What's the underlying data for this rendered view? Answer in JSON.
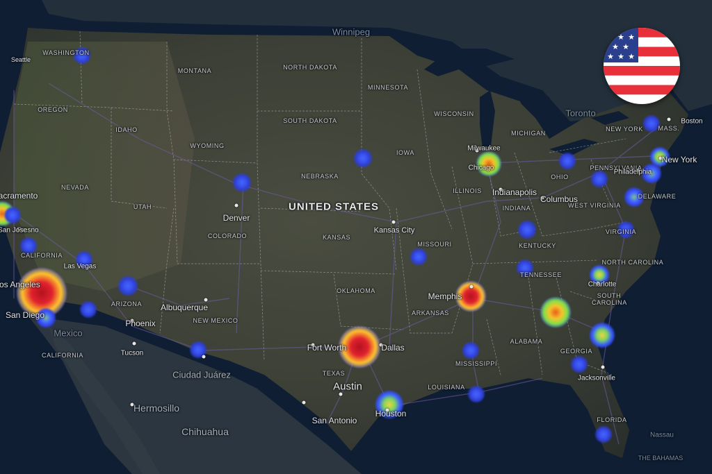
{
  "country_label": "UNITED STATES",
  "flag": {
    "name": "us-flag-icon",
    "red": "#e8303a",
    "white": "#ffffff",
    "blue": "#2b3f8f"
  },
  "faint_labels": [
    {
      "name": "winnipeg",
      "text": "Winnipeg"
    },
    {
      "name": "toronto",
      "text": "Toronto"
    },
    {
      "name": "mexico",
      "text": "Mexico"
    },
    {
      "name": "nassau",
      "text": "Nassau"
    },
    {
      "name": "the-bahamas",
      "text": "THE BAHAMAS"
    }
  ],
  "state_labels": [
    {
      "name": "washington",
      "text": "WASHINGTON"
    },
    {
      "name": "montana",
      "text": "MONTANA"
    },
    {
      "name": "north-dakota",
      "text": "NORTH DAKOTA"
    },
    {
      "name": "minnesota",
      "text": "MINNESOTA"
    },
    {
      "name": "oregon",
      "text": "OREGON"
    },
    {
      "name": "idaho",
      "text": "IDAHO"
    },
    {
      "name": "south-dakota",
      "text": "SOUTH DAKOTA"
    },
    {
      "name": "wisconsin",
      "text": "WISCONSIN"
    },
    {
      "name": "michigan",
      "text": "MICHIGAN"
    },
    {
      "name": "wyoming",
      "text": "WYOMING"
    },
    {
      "name": "iowa",
      "text": "IOWA"
    },
    {
      "name": "nebraska",
      "text": "NEBRASKA"
    },
    {
      "name": "nevada",
      "text": "NEVADA"
    },
    {
      "name": "utah",
      "text": "UTAH"
    },
    {
      "name": "illinois",
      "text": "ILLINOIS"
    },
    {
      "name": "indiana",
      "text": "INDIANA"
    },
    {
      "name": "ohio",
      "text": "OHIO"
    },
    {
      "name": "pennsylvania",
      "text": "PENNSYLVANIA"
    },
    {
      "name": "new-york",
      "text": "NEW YORK"
    },
    {
      "name": "mass",
      "text": "MASS."
    },
    {
      "name": "colorado",
      "text": "COLORADO"
    },
    {
      "name": "kansas",
      "text": "KANSAS"
    },
    {
      "name": "missouri",
      "text": "MISSOURI"
    },
    {
      "name": "kentucky",
      "text": "KENTUCKY"
    },
    {
      "name": "west-virginia",
      "text": "WEST VIRGINIA"
    },
    {
      "name": "virginia",
      "text": "VIRGINIA"
    },
    {
      "name": "delaware",
      "text": "DELAWARE"
    },
    {
      "name": "california",
      "text": "CALIFORNIA"
    },
    {
      "name": "arizona",
      "text": "ARIZONA"
    },
    {
      "name": "new-mexico",
      "text": "NEW MEXICO"
    },
    {
      "name": "oklahoma",
      "text": "OKLAHOMA"
    },
    {
      "name": "arkansas",
      "text": "ARKANSAS"
    },
    {
      "name": "tennessee",
      "text": "TENNESSEE"
    },
    {
      "name": "north-carolina",
      "text": "NORTH CAROLINA"
    },
    {
      "name": "south-carolina",
      "text": "SOUTH CAROLINA"
    },
    {
      "name": "texas",
      "text": "TEXAS"
    },
    {
      "name": "mississippi",
      "text": "MISSISSIPPI"
    },
    {
      "name": "alabama",
      "text": "ALABAMA"
    },
    {
      "name": "georgia",
      "text": "GEORGIA"
    },
    {
      "name": "louisiana",
      "text": "LOUISIANA"
    },
    {
      "name": "florida",
      "text": "FLORIDA"
    },
    {
      "name": "baja-california",
      "text": "CALIFORNIA"
    }
  ],
  "city_labels": [
    {
      "name": "seattle",
      "text": "Seattle"
    },
    {
      "name": "sacramento",
      "text": "Sacramento"
    },
    {
      "name": "fresno",
      "text": "Fresno"
    },
    {
      "name": "san-jose",
      "text": "San Jose"
    },
    {
      "name": "los-angeles",
      "text": "Los Angeles"
    },
    {
      "name": "las-vegas",
      "text": "Las Vegas"
    },
    {
      "name": "san-diego",
      "text": "San Diego"
    },
    {
      "name": "phoenix",
      "text": "Phoenix"
    },
    {
      "name": "tucson",
      "text": "Tucson"
    },
    {
      "name": "albuquerque",
      "text": "Albuquerque"
    },
    {
      "name": "denver",
      "text": "Denver"
    },
    {
      "name": "kansas-city",
      "text": "Kansas City"
    },
    {
      "name": "milwaukee",
      "text": "Milwaukee"
    },
    {
      "name": "chicago",
      "text": "Chicago"
    },
    {
      "name": "indianapolis",
      "text": "Indianapolis"
    },
    {
      "name": "columbus",
      "text": "Columbus"
    },
    {
      "name": "philadelphia",
      "text": "Philadelphia"
    },
    {
      "name": "new-york-city",
      "text": "New York"
    },
    {
      "name": "boston",
      "text": "Boston"
    },
    {
      "name": "memphis",
      "text": "Memphis"
    },
    {
      "name": "charlotte",
      "text": "Charlotte"
    },
    {
      "name": "fort-worth",
      "text": "Fort Worth"
    },
    {
      "name": "dallas",
      "text": "Dallas"
    },
    {
      "name": "austin",
      "text": "Austin"
    },
    {
      "name": "houston",
      "text": "Houston"
    },
    {
      "name": "san-antonio",
      "text": "San Antonio"
    },
    {
      "name": "jacksonville",
      "text": "Jacksonville"
    },
    {
      "name": "ciudad-juarez",
      "text": "Ciudad Juárez"
    },
    {
      "name": "hermosillo",
      "text": "Hermosillo"
    },
    {
      "name": "chihuahua",
      "text": "Chihuahua"
    }
  ],
  "hotspots": [
    {
      "name": "los-angeles",
      "intensity": 1.0
    },
    {
      "name": "fort-worth-dallas",
      "intensity": 0.95
    },
    {
      "name": "memphis",
      "intensity": 0.9
    },
    {
      "name": "san-jose",
      "intensity": 0.75
    },
    {
      "name": "atlanta",
      "intensity": 0.6
    },
    {
      "name": "chicago",
      "intensity": 0.55
    },
    {
      "name": "houston",
      "intensity": 0.45
    },
    {
      "name": "savannah",
      "intensity": 0.4
    },
    {
      "name": "charlotte",
      "intensity": 0.3
    },
    {
      "name": "new-york",
      "intensity": 0.3
    },
    {
      "name": "philadelphia",
      "intensity": 0.25
    },
    {
      "name": "baltimore",
      "intensity": 0.25
    },
    {
      "name": "san-diego",
      "intensity": 0.2
    },
    {
      "name": "seattle",
      "intensity": 0.1
    },
    {
      "name": "sacramento",
      "intensity": 0.1
    },
    {
      "name": "fresno",
      "intensity": 0.1
    },
    {
      "name": "las-vegas",
      "intensity": 0.1
    },
    {
      "name": "phoenix",
      "intensity": 0.1
    },
    {
      "name": "tucson",
      "intensity": 0.1
    },
    {
      "name": "el-paso",
      "intensity": 0.1
    },
    {
      "name": "denver",
      "intensity": 0.1
    },
    {
      "name": "omaha",
      "intensity": 0.1
    },
    {
      "name": "kansas-city",
      "intensity": 0.1
    },
    {
      "name": "indianapolis",
      "intensity": 0.1
    },
    {
      "name": "louisville",
      "intensity": 0.1
    },
    {
      "name": "nashville",
      "intensity": 0.1
    },
    {
      "name": "jackson",
      "intensity": 0.1
    },
    {
      "name": "new-orleans",
      "intensity": 0.1
    },
    {
      "name": "ohio",
      "intensity": 0.1
    },
    {
      "name": "pittsburgh",
      "intensity": 0.1
    },
    {
      "name": "richmond",
      "intensity": 0.1
    },
    {
      "name": "boston",
      "intensity": 0.1
    },
    {
      "name": "jacksonville",
      "intensity": 0.1
    },
    {
      "name": "tampa",
      "intensity": 0.1
    }
  ]
}
